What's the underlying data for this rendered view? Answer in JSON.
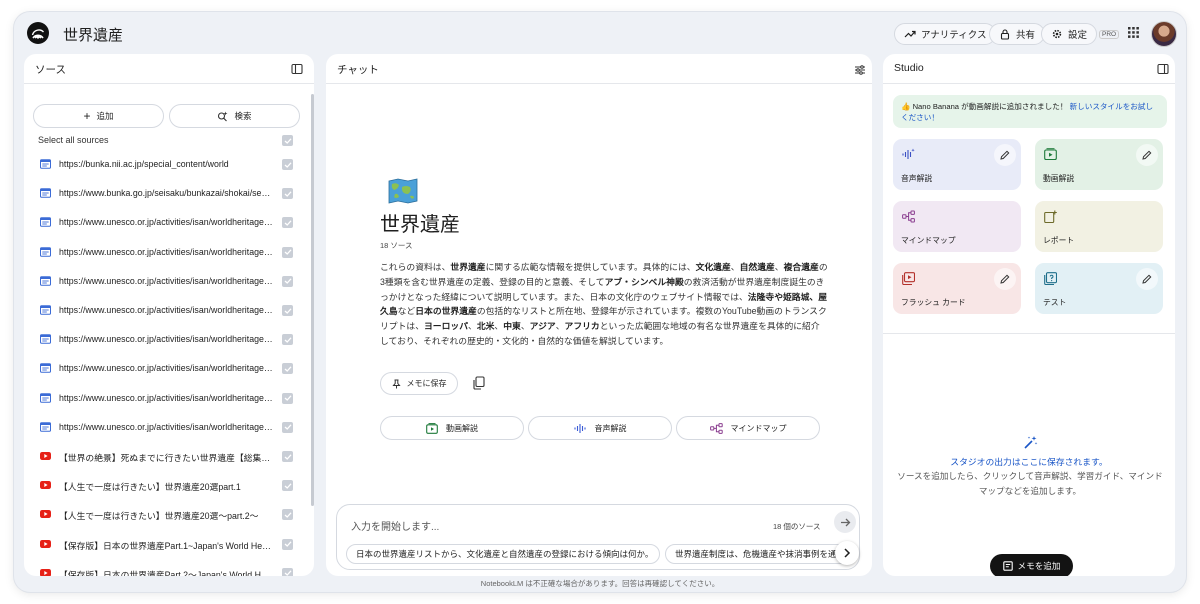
{
  "app": {
    "title": "世界遺産"
  },
  "header": {
    "analytics": "アナリティクス",
    "share": "共有",
    "settings": "設定",
    "pro": "PRO"
  },
  "sources": {
    "title": "ソース",
    "add": "追加",
    "search": "検索",
    "select_all": "Select all sources",
    "items": [
      {
        "type": "web",
        "label": "https://bunka.nii.ac.jp/special_content/world"
      },
      {
        "type": "web",
        "label": "https://www.bunka.go.jp/seisaku/bunkazai/shokai/sekai..."
      },
      {
        "type": "web",
        "label": "https://www.unesco.or.jp/activities/isan/worldheritageli..."
      },
      {
        "type": "web",
        "label": "https://www.unesco.or.jp/activities/isan/worldheritageli..."
      },
      {
        "type": "web",
        "label": "https://www.unesco.or.jp/activities/isan/worldheritageli..."
      },
      {
        "type": "web",
        "label": "https://www.unesco.or.jp/activities/isan/worldheritageli..."
      },
      {
        "type": "web",
        "label": "https://www.unesco.or.jp/activities/isan/worldheritageli..."
      },
      {
        "type": "web",
        "label": "https://www.unesco.or.jp/activities/isan/worldheritageli..."
      },
      {
        "type": "web",
        "label": "https://www.unesco.or.jp/activities/isan/worldheritageli..."
      },
      {
        "type": "web",
        "label": "https://www.unesco.or.jp/activities/isan/worldheritageli..."
      },
      {
        "type": "youtube",
        "label": "【世界の絶景】死ぬまでに行きたい世界遺産【総集編】"
      },
      {
        "type": "youtube",
        "label": "【人生で一度は行きたい】世界遺産20選part.1"
      },
      {
        "type": "youtube",
        "label": "【人生で一度は行きたい】世界遺産20選〜part.2〜"
      },
      {
        "type": "youtube",
        "label": "【保存版】日本の世界遺産Part.1~Japan's World Herita..."
      },
      {
        "type": "youtube",
        "label": "【保存版】日本の世界遺産Part.2〜Japan's World Herit..."
      }
    ]
  },
  "chat": {
    "title": "チャット",
    "notebook_title": "世界遺産",
    "source_count": "18 ソース",
    "summary": [
      {
        "t": "これらの資料は、"
      },
      {
        "b": "世界遺産"
      },
      {
        "t": "に関する広範な情報を提供しています。具体的には、"
      },
      {
        "b": "文化遺産"
      },
      {
        "t": "、"
      },
      {
        "b": "自然遺産"
      },
      {
        "t": "、"
      },
      {
        "b": "複合遺産"
      },
      {
        "t": "の3種類を含む世界遺産の定義、登録の目的と意義、そして"
      },
      {
        "b": "アブ・シンベル神殿"
      },
      {
        "t": "の救済活動が世界遺産制度誕生のきっかけとなった経緯について説明しています。また、日本の文化庁のウェブサイト情報では、"
      },
      {
        "b": "法隆寺や姫路城、屋久島"
      },
      {
        "t": "など"
      },
      {
        "b": "日本の世界遺産"
      },
      {
        "t": "の包括的なリストと所在地、登録年が示されています。複数のYouTube動画のトランスクリプトは、"
      },
      {
        "b": "ヨーロッパ"
      },
      {
        "t": "、"
      },
      {
        "b": "北米"
      },
      {
        "t": "、"
      },
      {
        "b": "中東"
      },
      {
        "t": "、"
      },
      {
        "b": "アジア"
      },
      {
        "t": "、"
      },
      {
        "b": "アフリカ"
      },
      {
        "t": "といった広範囲な地域の有名な世界遺産を具体的に紹介しており、それぞれの歴史的・文化的・自然的な価値を解説しています。"
      }
    ],
    "save_memo": "メモに保存",
    "chips": [
      "動画解説",
      "音声解説",
      "マインドマップ"
    ],
    "input_placeholder": "入力を開始します...",
    "input_source_count": "18 個のソース",
    "suggestions": [
      "日本の世界遺産リストから、文化遺産と自然遺産の登録における傾向は何か。",
      "世界遺産制度は、危機遺産や抹消事例を通"
    ]
  },
  "studio": {
    "title": "Studio",
    "banner_text": "👍 Nano Banana が動画解説に追加されました！",
    "banner_link": "新しいスタイルをお試しください！",
    "cards": [
      {
        "label": "音声解説",
        "color": "#e8ebf8",
        "icon": "audio-waveform-icon",
        "editable": true
      },
      {
        "label": "動画解説",
        "color": "#e3f1e6",
        "icon": "video-play-icon",
        "editable": true
      },
      {
        "label": "マインドマップ",
        "color": "#f1e8f3",
        "icon": "mindmap-icon",
        "editable": false
      },
      {
        "label": "レポート",
        "color": "#f2f1e3",
        "icon": "report-icon",
        "editable": false
      },
      {
        "label": "フラッシュ カード",
        "color": "#f8e6e6",
        "icon": "flashcard-icon",
        "editable": true
      },
      {
        "label": "テスト",
        "color": "#e2f0f5",
        "icon": "quiz-icon",
        "editable": true
      }
    ],
    "empty_title": "スタジオの出力はここに保存されます。",
    "empty_desc": "ソースを追加したら、クリックして音声解説、学習ガイド、マインドマップなどを追加します。",
    "add_note": "メモを追加"
  },
  "footer": "NotebookLM は不正確な場合があります。回答は再確認してください。",
  "colors": {
    "link": "#1a56c7",
    "youtube": "#e62117",
    "web": "#3b6bd6"
  }
}
